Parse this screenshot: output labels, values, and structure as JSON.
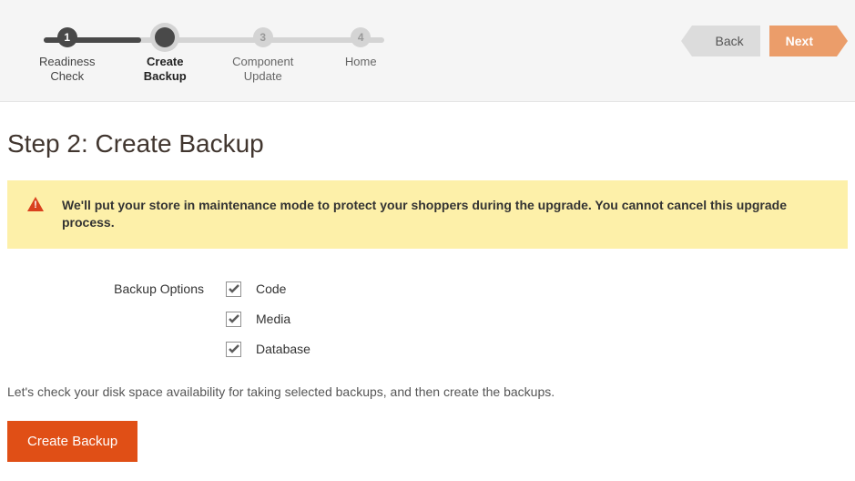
{
  "steps": [
    {
      "num": "1",
      "label_l1": "Readiness",
      "label_l2": "Check",
      "state": "done"
    },
    {
      "num": "",
      "label_l1": "Create",
      "label_l2": "Backup",
      "state": "current"
    },
    {
      "num": "3",
      "label_l1": "Component",
      "label_l2": "Update",
      "state": "pending"
    },
    {
      "num": "4",
      "label_l1": "Home",
      "label_l2": "",
      "state": "pending"
    }
  ],
  "nav": {
    "back": "Back",
    "next": "Next"
  },
  "page_title": "Step 2: Create Backup",
  "warning": "We'll put your store in maintenance mode to protect your shoppers during the upgrade. You cannot cancel this upgrade process.",
  "backup_options_label": "Backup Options",
  "backup_options": [
    {
      "label": "Code",
      "checked": true
    },
    {
      "label": "Media",
      "checked": true
    },
    {
      "label": "Database",
      "checked": true
    }
  ],
  "helper_text": "Let's check your disk space availability for taking selected backups, and then create the backups.",
  "create_button": "Create Backup"
}
